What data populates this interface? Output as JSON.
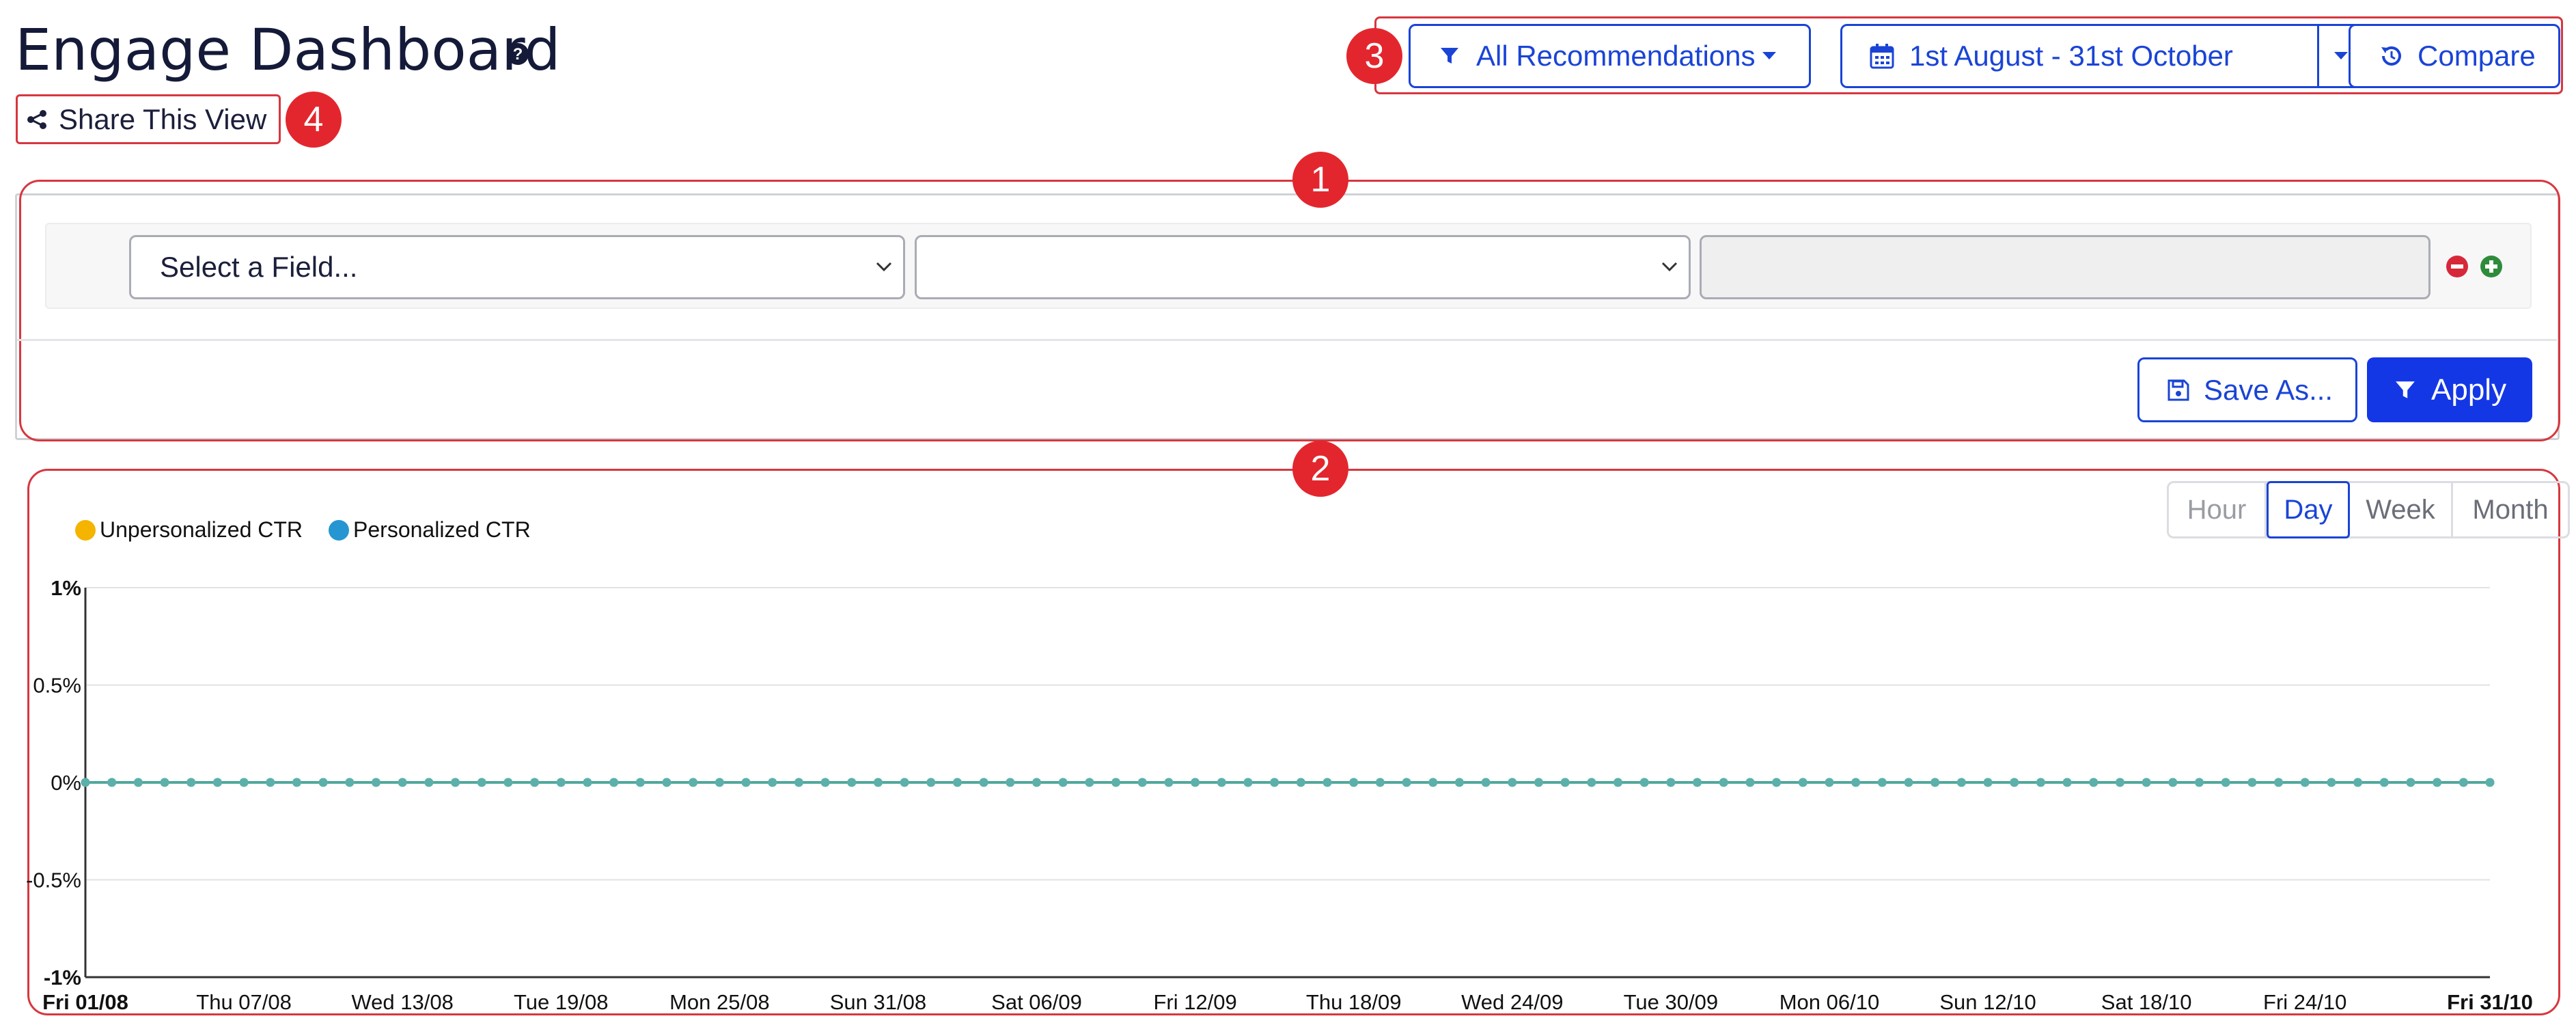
{
  "header": {
    "title": "Engage Dashboard",
    "share_label": "Share This View"
  },
  "toolbar": {
    "recommendations_label": "All Recommendations",
    "date_range_label": "1st August - 31st October",
    "compare_label": "Compare"
  },
  "filter": {
    "field_placeholder": "Select a Field...",
    "operator_value": "",
    "value_input": "",
    "save_as_label": "Save As...",
    "apply_label": "Apply"
  },
  "annotations": {
    "filter": "1",
    "chart": "2",
    "toolbar": "3",
    "share": "4"
  },
  "period_buttons": [
    "Hour",
    "Day",
    "Week",
    "Month"
  ],
  "period_selected": "Day",
  "colors": {
    "accent": "#1a44d6",
    "primary_button": "#1437e6",
    "annotation_red": "#e3262d",
    "unpersonalized": "#f4b400",
    "personalized": "#2596d1",
    "line": "#4fa89a"
  },
  "chart_data": {
    "type": "line",
    "legend": [
      "Unpersonalized CTR",
      "Personalized CTR"
    ],
    "legend_placement": "top-left",
    "grid": true,
    "ylim": [
      -1,
      1
    ],
    "y_ticks": [
      "1%",
      "0.5%",
      "0%",
      "-0.5%",
      "-1%"
    ],
    "x_ticks": [
      "Fri 01/08",
      "Thu 07/08",
      "Wed 13/08",
      "Tue 19/08",
      "Mon 25/08",
      "Sun 31/08",
      "Sat 06/09",
      "Fri 12/09",
      "Thu 18/09",
      "Wed 24/09",
      "Tue 30/09",
      "Mon 06/10",
      "Sun 12/10",
      "Sat 18/10",
      "Fri 24/10",
      "Fri 31/10"
    ],
    "x_range": [
      "2025-08-01",
      "2025-10-31"
    ],
    "series": [
      {
        "name": "Unpersonalized CTR",
        "color": "#f4b400",
        "value_all_days": 0
      },
      {
        "name": "Personalized CTR",
        "color": "#2596d1",
        "value_all_days": 0
      }
    ],
    "point_count": 92
  }
}
